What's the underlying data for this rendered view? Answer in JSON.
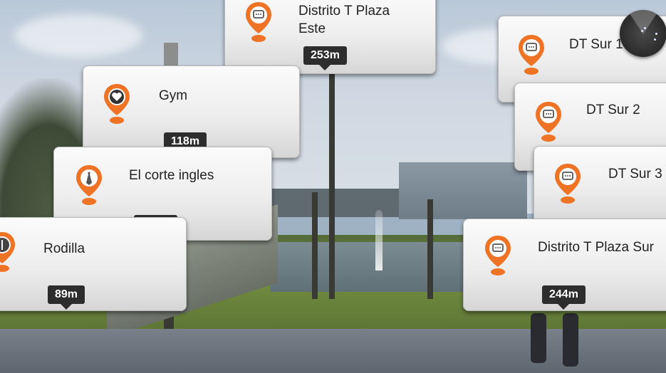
{
  "colors": {
    "pin_orange": "#ee7325",
    "card_text": "#222222",
    "distance_bg": "#2d2d2d"
  },
  "markers": [
    {
      "name": "Distrito T Plaza",
      "name_line2": "Este",
      "distance": "253m",
      "icon": "message-icon"
    },
    {
      "name": "Gym",
      "distance": "118m",
      "icon": "heart-icon"
    },
    {
      "name": "El corte ingles",
      "distance": "103m",
      "icon": "tie-icon"
    },
    {
      "name": "Rodilla",
      "distance": "89m",
      "icon": "restaurant-icon"
    },
    {
      "name": "DT Sur 1",
      "distance": "",
      "icon": "message-icon"
    },
    {
      "name": "DT Sur 2",
      "distance": "",
      "icon": "message-icon"
    },
    {
      "name": "DT Sur 3",
      "distance": "",
      "icon": "message-icon"
    },
    {
      "name": "Distrito T Plaza Sur",
      "distance": "244m",
      "icon": "message-icon"
    }
  ],
  "radar": {
    "icon": "radar-icon"
  }
}
